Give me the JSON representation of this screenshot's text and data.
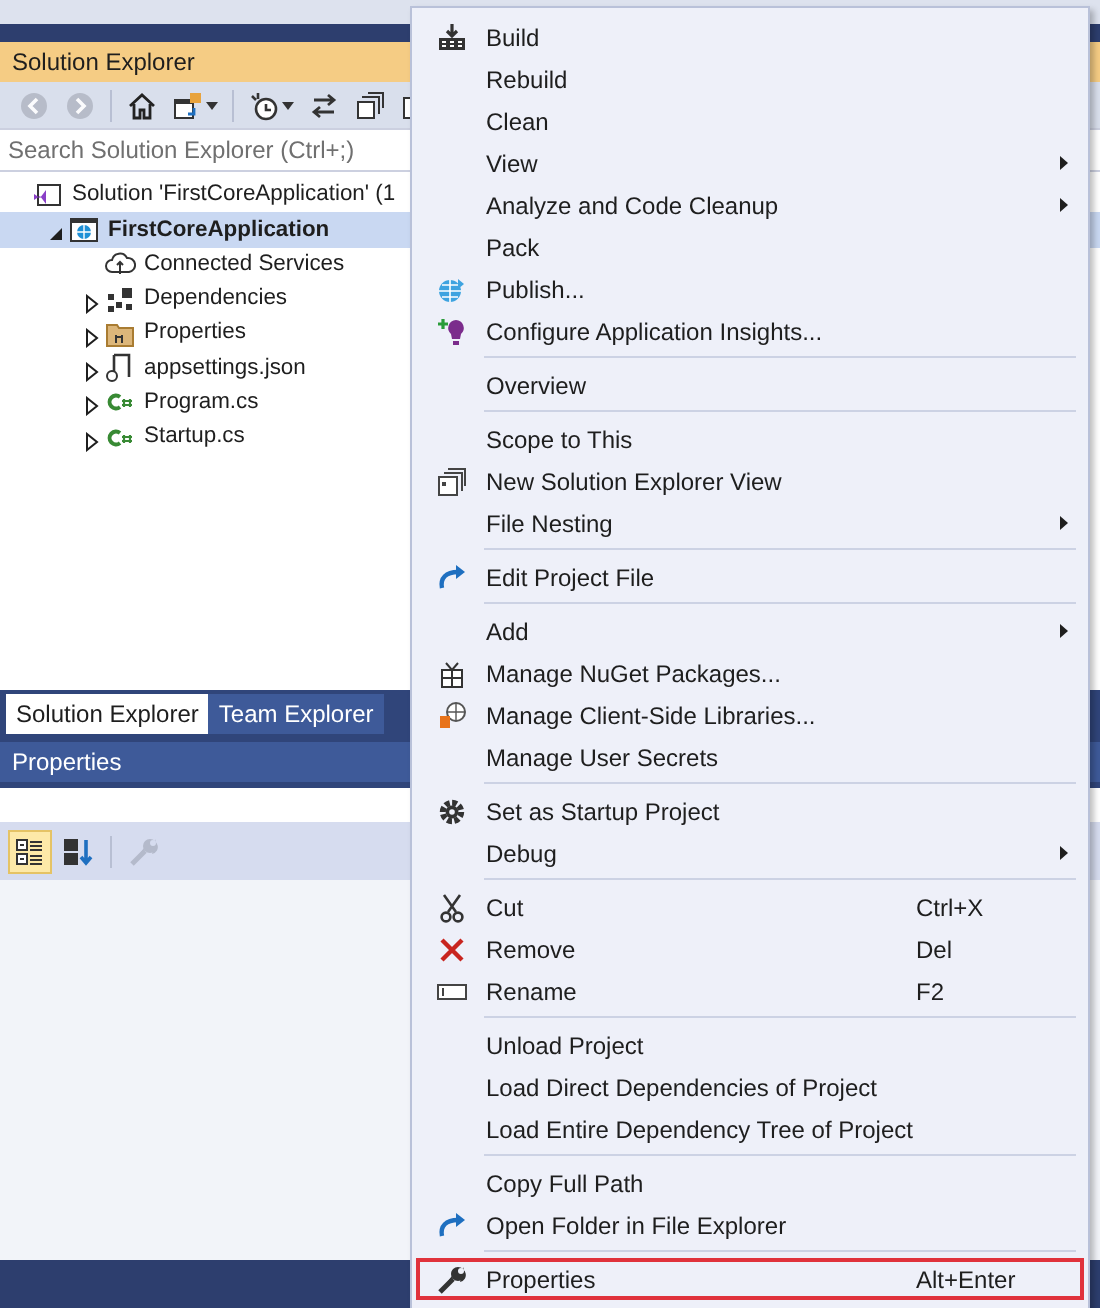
{
  "solution_explorer": {
    "title": "Solution Explorer",
    "toolbar": [
      {
        "disabled": true
      },
      {
        "disabled": true
      },
      {
        "disabled": false
      },
      {
        "disabled": false
      },
      {
        "disabled": false
      },
      {
        "disabled": false
      },
      {
        "disabled": false
      },
      {
        "disabled": false
      }
    ],
    "search": {
      "placeholder": "Search Solution Explorer (Ctrl+;)"
    },
    "tree": [
      {
        "label": "Solution 'FirstCoreApplication' (1",
        "selected": false,
        "children": [
          {
            "label": "FirstCoreApplication",
            "selected": true,
            "expanded": true,
            "children": [
              {
                "label": "Connected Services",
                "selected": false
              },
              {
                "label": "Dependencies",
                "selected": false,
                "expanded": false
              },
              {
                "label": "Properties",
                "selected": false,
                "expanded": false
              },
              {
                "label": "appsettings.json",
                "selected": false,
                "expanded": false
              },
              {
                "label": "Program.cs",
                "selected": false,
                "expanded": false
              },
              {
                "label": "Startup.cs",
                "selected": false,
                "expanded": false
              }
            ]
          }
        ]
      }
    ]
  },
  "tabs": [
    {
      "label": "Solution Explorer",
      "selected": true
    },
    {
      "label": "Team Explorer",
      "selected": false
    }
  ],
  "properties_panel": {
    "title": "Properties",
    "toolbar": [
      {
        "selected": true,
        "disabled": false
      },
      {
        "selected": false,
        "disabled": false
      },
      {
        "selected": false,
        "disabled": true
      }
    ]
  },
  "context_menu": [
    {
      "kind": "item",
      "label": "Build",
      "submenu": false,
      "highlighted": false
    },
    {
      "kind": "item",
      "label": "Rebuild",
      "submenu": false,
      "highlighted": false
    },
    {
      "kind": "item",
      "label": "Clean",
      "submenu": false,
      "highlighted": false
    },
    {
      "kind": "item",
      "label": "View",
      "submenu": true,
      "highlighted": false
    },
    {
      "kind": "item",
      "label": "Analyze and Code Cleanup",
      "submenu": true,
      "highlighted": false
    },
    {
      "kind": "item",
      "label": "Pack",
      "submenu": false,
      "highlighted": false
    },
    {
      "kind": "item",
      "label": "Publish...",
      "submenu": false,
      "highlighted": false
    },
    {
      "kind": "item",
      "label": "Configure Application Insights...",
      "submenu": false,
      "highlighted": false
    },
    {
      "kind": "separator"
    },
    {
      "kind": "item",
      "label": "Overview",
      "submenu": false,
      "highlighted": false
    },
    {
      "kind": "separator"
    },
    {
      "kind": "item",
      "label": "Scope to This",
      "submenu": false,
      "highlighted": false
    },
    {
      "kind": "item",
      "label": "New Solution Explorer View",
      "submenu": false,
      "highlighted": false
    },
    {
      "kind": "item",
      "label": "File Nesting",
      "submenu": true,
      "highlighted": false
    },
    {
      "kind": "separator"
    },
    {
      "kind": "item",
      "label": "Edit Project File",
      "submenu": false,
      "highlighted": false
    },
    {
      "kind": "separator"
    },
    {
      "kind": "item",
      "label": "Add",
      "submenu": true,
      "highlighted": false
    },
    {
      "kind": "item",
      "label": "Manage NuGet Packages...",
      "submenu": false,
      "highlighted": false
    },
    {
      "kind": "item",
      "label": "Manage Client-Side Libraries...",
      "submenu": false,
      "highlighted": false
    },
    {
      "kind": "item",
      "label": "Manage User Secrets",
      "submenu": false,
      "highlighted": false
    },
    {
      "kind": "separator"
    },
    {
      "kind": "item",
      "label": "Set as Startup Project",
      "submenu": false,
      "highlighted": false
    },
    {
      "kind": "item",
      "label": "Debug",
      "submenu": true,
      "highlighted": false
    },
    {
      "kind": "separator"
    },
    {
      "kind": "item",
      "label": "Cut",
      "shortcut": "Ctrl+X",
      "submenu": false,
      "highlighted": false
    },
    {
      "kind": "item",
      "label": "Remove",
      "shortcut": "Del",
      "submenu": false,
      "highlighted": false
    },
    {
      "kind": "item",
      "label": "Rename",
      "shortcut": "F2",
      "submenu": false,
      "highlighted": false
    },
    {
      "kind": "separator"
    },
    {
      "kind": "item",
      "label": "Unload Project",
      "submenu": false,
      "highlighted": false
    },
    {
      "kind": "item",
      "label": "Load Direct Dependencies of Project",
      "submenu": false,
      "highlighted": false
    },
    {
      "kind": "item",
      "label": "Load Entire Dependency Tree of Project",
      "submenu": false,
      "highlighted": false
    },
    {
      "kind": "separator"
    },
    {
      "kind": "item",
      "label": "Copy Full Path",
      "submenu": false,
      "highlighted": false
    },
    {
      "kind": "item",
      "label": "Open Folder in File Explorer",
      "submenu": false,
      "highlighted": false
    },
    {
      "kind": "separator"
    },
    {
      "kind": "item",
      "label": "Properties",
      "shortcut": "Alt+Enter",
      "submenu": false,
      "highlighted": true
    }
  ]
}
